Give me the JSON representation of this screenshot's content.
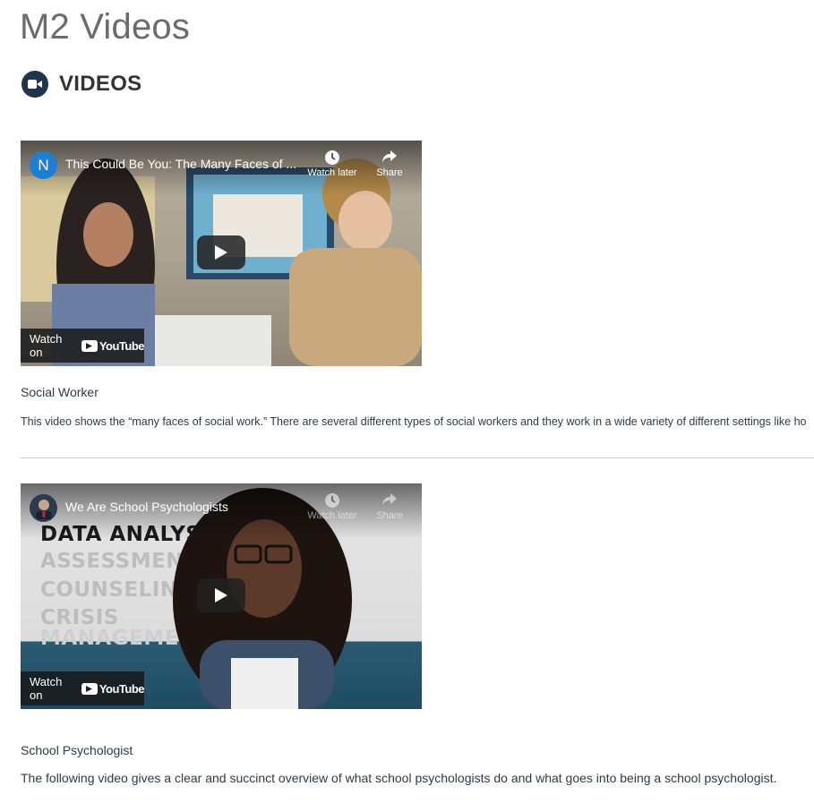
{
  "page": {
    "title": "M2 Videos"
  },
  "section": {
    "title": "VIDEOS",
    "icon": "video-camera-icon"
  },
  "videos": [
    {
      "channel_initial": "N",
      "title": "This Could Be You: The Many Faces of ...",
      "watch_later_label": "Watch later",
      "share_label": "Share",
      "watch_on_label": "Watch on",
      "youtube_label": "YouTube",
      "caption": "Social Worker",
      "description": "This video shows the “many faces of social work.” There are several different types of social workers and they work in a wide variety of different settings like ho"
    },
    {
      "channel_initial": "",
      "title": "We Are School Psychologists",
      "watch_later_label": "Watch later",
      "share_label": "Share",
      "watch_on_label": "Watch on",
      "youtube_label": "YouTube",
      "overlay_words": [
        "DATA ANALYSIS",
        "ASSESSMENT",
        "COUNSELING",
        "CRISIS",
        "MANAGEMENT"
      ],
      "caption": "School Psychologist",
      "description": "The following video gives a clear and succinct overview of what school psychologists do and what goes into being a school psychologist."
    }
  ],
  "colors": {
    "section_icon_bg": "#1e3550",
    "channel_avatar_bg": "#1c7fd6",
    "divider": "#c7cdd1"
  }
}
